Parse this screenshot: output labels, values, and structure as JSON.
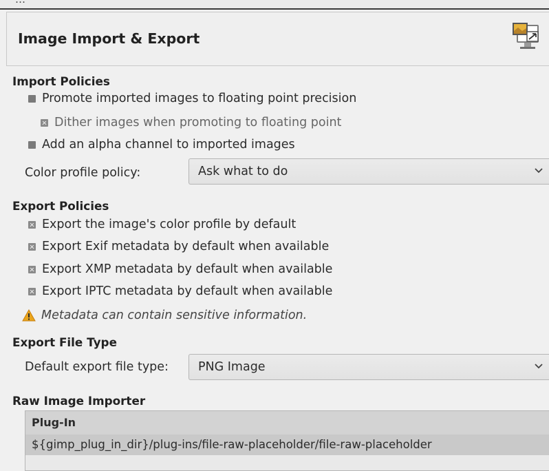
{
  "top_strip": {
    "partial_text": "…"
  },
  "header": {
    "title": "Image Import & Export",
    "icon": "display-import-export-icon"
  },
  "import_policies": {
    "heading": "Import Policies",
    "promote": "Promote imported images to floating point precision",
    "dither": "Dither images when promoting to floating point",
    "alpha": "Add an alpha channel to imported images",
    "color_profile_label": "Color profile policy:",
    "color_profile_value": "Ask what to do"
  },
  "export_policies": {
    "heading": "Export Policies",
    "items": [
      "Export the image's color profile by default",
      "Export Exif metadata by default when available",
      "Export XMP metadata by default when available",
      "Export IPTC metadata by default when available"
    ],
    "warning": "Metadata can contain sensitive information."
  },
  "export_file_type": {
    "heading": "Export File Type",
    "label": "Default export file type:",
    "value": "PNG Image"
  },
  "raw_importer": {
    "heading": "Raw Image Importer",
    "column": "Plug-In",
    "rows": [
      "${gimp_plug_in_dir}/plug-ins/file-raw-placeholder/file-raw-placeholder"
    ]
  },
  "colors": {
    "warning": "#e9a51c",
    "selection": "#c9c9c9"
  }
}
